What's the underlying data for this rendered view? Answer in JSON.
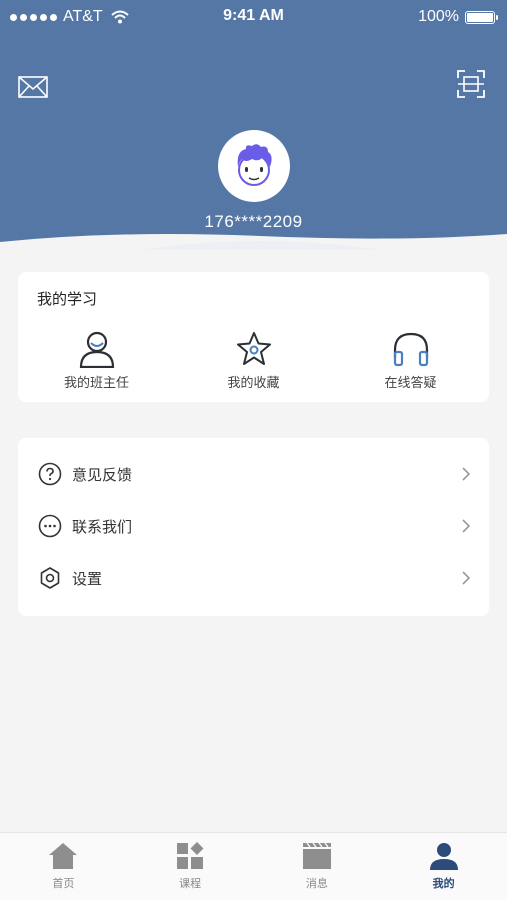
{
  "status_bar": {
    "carrier": "AT&T",
    "time": "9:41 AM",
    "battery": "100%"
  },
  "profile": {
    "phone": "176****2209"
  },
  "study": {
    "title": "我的学习",
    "items": [
      {
        "label": "我的班主任",
        "icon": "teacher-icon"
      },
      {
        "label": "我的收藏",
        "icon": "star-icon"
      },
      {
        "label": "在线答疑",
        "icon": "headphones-icon"
      }
    ]
  },
  "menu": {
    "items": [
      {
        "label": "意见反馈",
        "icon": "question-icon"
      },
      {
        "label": "联系我们",
        "icon": "chat-icon"
      },
      {
        "label": "设置",
        "icon": "settings-icon"
      }
    ]
  },
  "tabbar": {
    "items": [
      {
        "label": "首页",
        "icon": "home-icon",
        "active": false
      },
      {
        "label": "课程",
        "icon": "grid-icon",
        "active": false
      },
      {
        "label": "消息",
        "icon": "message-icon",
        "active": false
      },
      {
        "label": "我的",
        "icon": "user-icon",
        "active": true
      }
    ]
  },
  "colors": {
    "header": "#5577a5",
    "accent": "#2c4a7a",
    "avatar_hair": "#6b5ce7"
  }
}
